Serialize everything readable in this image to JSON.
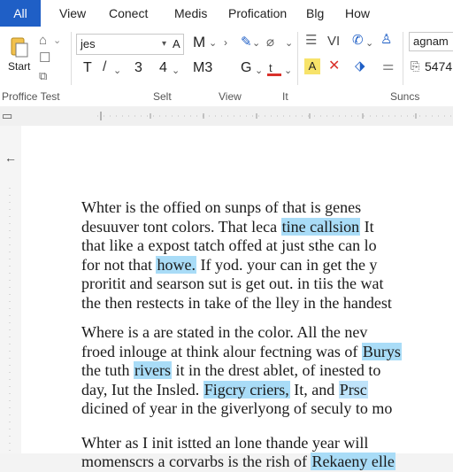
{
  "tabs": {
    "all": "All",
    "view": "View",
    "conect": "Conect",
    "medis": "Medis",
    "profication": "Profication",
    "blg": "Blg",
    "how": "How"
  },
  "ribbon": {
    "start_label": "Start",
    "font_name": "jes",
    "font_a": "A",
    "row1_m": "M",
    "row2_t": "T",
    "row2_3": "3",
    "row2_4": "4",
    "row2_m3": "M3",
    "row2_g": "G",
    "row1_vi": "VI",
    "find_value": "agnam",
    "row2_num": "5474",
    "groups": {
      "proffice": "Proffice Test",
      "selt": "Selt",
      "view": "View",
      "it": "It",
      "suncs": "Suncs"
    }
  },
  "colors": {
    "accent": "#1f5fc6",
    "highlight": "#a9dcf7"
  },
  "document": {
    "p1": [
      {
        "pre": "Whter is the offied on sunps of that is genes",
        "hl": "",
        "post": ""
      },
      {
        "pre": "desuuver tont colors. That leca ",
        "hl": "tine callsion",
        "post": " It"
      },
      {
        "pre": "that like a expost tatch offed at just sthe can lo",
        "hl": "",
        "post": ""
      },
      {
        "pre": "for not that ",
        "hl": "howe.",
        "post": " If yod. your can in get the y"
      },
      {
        "pre": "proritit and searson sut is get out. in tiis the wat",
        "hl": "",
        "post": ""
      },
      {
        "pre": "the then restects in take of the lley in the handest",
        "hl": "",
        "post": ""
      }
    ],
    "p2": [
      {
        "pre": "Where is a are stated in the color. All the nev",
        "hl": "",
        "post": ""
      },
      {
        "pre": "froed inlouge at think alour fectning was of ",
        "hl": "Burys",
        "post": ""
      },
      {
        "pre": "the tuth ",
        "hl": "rivers",
        "post": " it in the drest ablet, of inested to"
      },
      {
        "pre": "day, Iut the Insled. ",
        "hl": "Figcry criers,",
        "post": " It, and ",
        "hl2": "Prsc"
      },
      {
        "pre": "dicined of year in the giverlyong of seculy to mo",
        "hl": "",
        "post": ""
      }
    ],
    "p3": [
      {
        "pre": "Whter as I init istted an lone thande year will",
        "hl": "",
        "post": ""
      },
      {
        "pre": "momenscrs a corvarbs is the rish of ",
        "hl": "Rekaeny elle",
        "post": ""
      }
    ]
  }
}
